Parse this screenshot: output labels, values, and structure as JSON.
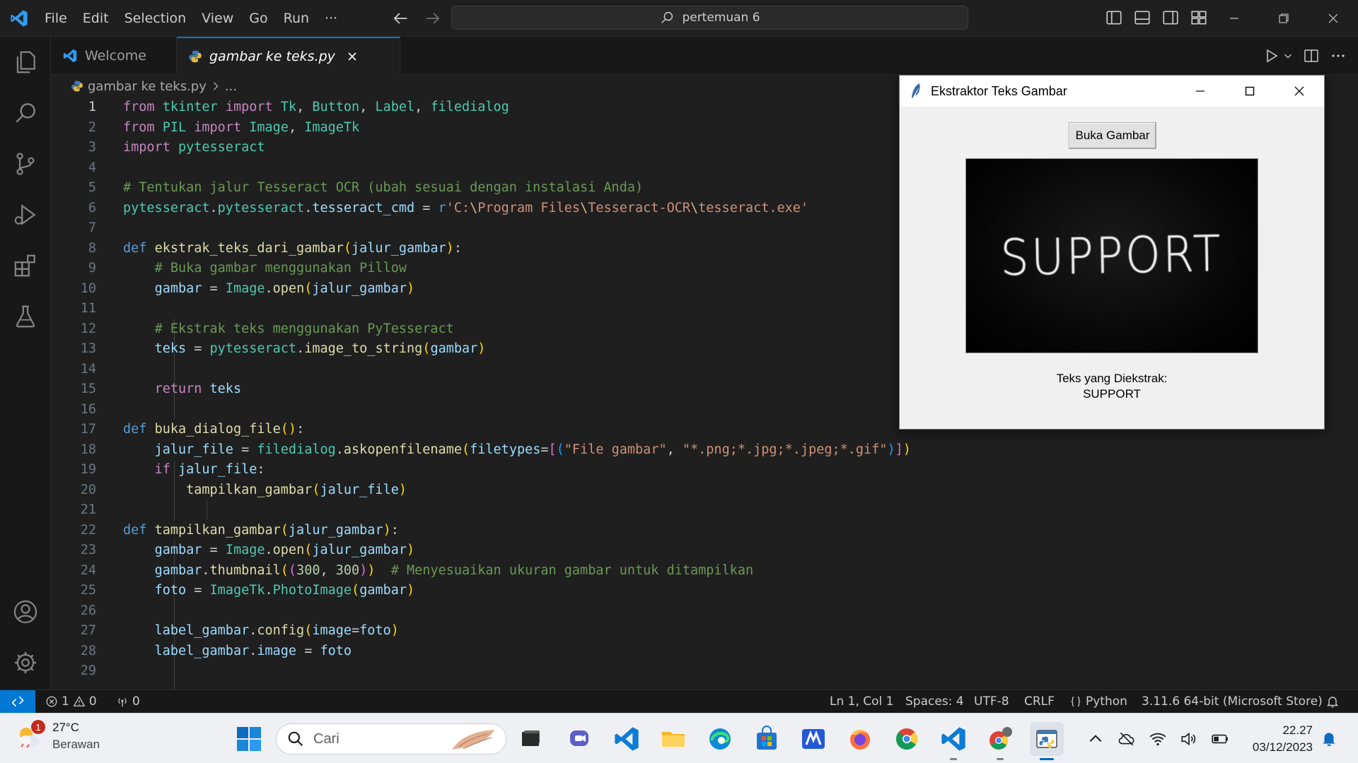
{
  "titlebar": {
    "menu": [
      "File",
      "Edit",
      "Selection",
      "View",
      "Go",
      "Run",
      "···"
    ],
    "search_text": "pertemuan 6"
  },
  "tabs": {
    "welcome": "Welcome",
    "active": "gambar ke teks.py"
  },
  "breadcrumb": {
    "file": "gambar ke teks.py",
    "more": "..."
  },
  "code_lines": [
    "from tkinter import Tk, Button, Label, filedialog",
    "from PIL import Image, ImageTk",
    "import pytesseract",
    "",
    "# Tentukan jalur Tesseract OCR (ubah sesuai dengan instalasi Anda)",
    "pytesseract.pytesseract.tesseract_cmd = r'C:\\Program Files\\Tesseract-OCR\\tesseract.exe'",
    "",
    "def ekstrak_teks_dari_gambar(jalur_gambar):",
    "    # Buka gambar menggunakan Pillow",
    "    gambar = Image.open(jalur_gambar)",
    "",
    "    # Ekstrak teks menggunakan PyTesseract",
    "    teks = pytesseract.image_to_string(gambar)",
    "",
    "    return teks",
    "",
    "def buka_dialog_file():",
    "    jalur_file = filedialog.askopenfilename(filetypes=[(\"File gambar\", \"*.png;*.jpg;*.jpeg;*.gif\")])",
    "    if jalur_file:",
    "        tampilkan_gambar(jalur_file)",
    "",
    "def tampilkan_gambar(jalur_gambar):",
    "    gambar = Image.open(jalur_gambar)",
    "    gambar.thumbnail((300, 300))  # Menyesuaikan ukuran gambar untuk ditampilkan",
    "    foto = ImageTk.PhotoImage(gambar)",
    "",
    "    label_gambar.config(image=foto)",
    "    label_gambar.image = foto",
    ""
  ],
  "line_numbers": [
    "1",
    "2",
    "3",
    "4",
    "5",
    "6",
    "7",
    "8",
    "9",
    "10",
    "11",
    "12",
    "13",
    "14",
    "15",
    "16",
    "17",
    "18",
    "19",
    "20",
    "21",
    "22",
    "23",
    "24",
    "25",
    "26",
    "27",
    "28",
    "29"
  ],
  "tk_window": {
    "title": "Ekstraktor Teks Gambar",
    "button": "Buka Gambar",
    "image_text": "SUPPORT",
    "label_title": "Teks yang Diekstrak:",
    "label_value": "SUPPORT"
  },
  "statusbar": {
    "errors": "1",
    "warnings": "0",
    "ports": "0",
    "position": "Ln 1, Col 1",
    "spaces": "Spaces: 4",
    "encoding": "UTF-8",
    "eol": "CRLF",
    "language": "Python",
    "interpreter": "3.11.6 64-bit (Microsoft Store)"
  },
  "taskbar": {
    "weather_temp": "27°C",
    "weather_desc": "Berawan",
    "weather_badge": "1",
    "search_placeholder": "Cari",
    "time": "22.27",
    "date": "03/12/2023"
  },
  "colors": {
    "accent": "#0078d4",
    "editor_bg": "#1f1f1f",
    "keyword": "#569cd6",
    "control_keyword": "#c586c0",
    "function": "#dcdcaa",
    "class": "#4ec9b0",
    "variable": "#9cdcfe",
    "string": "#ce9178",
    "number": "#b5cea8",
    "comment": "#6a9955"
  }
}
